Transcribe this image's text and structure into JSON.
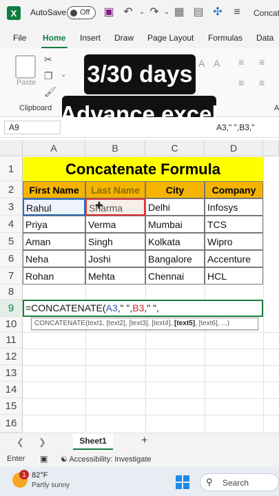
{
  "titlebar": {
    "logo": "X",
    "autosave_label": "AutoSave",
    "toggle_state": "Off",
    "doc_title": "Concat"
  },
  "menu": {
    "tabs": [
      "File",
      "Home",
      "Insert",
      "Draw",
      "Page Layout",
      "Formulas",
      "Data"
    ],
    "active": "Home"
  },
  "ribbon": {
    "paste_label": "Paste",
    "clipboard_label": "Clipboard",
    "overflow_label": "A"
  },
  "overlay": {
    "line1": "3/30 days",
    "line2": "Advance excel"
  },
  "formula_bar": {
    "name_box": "A9",
    "content": "A3,\"  \",B3,\""
  },
  "grid": {
    "columns": [
      "A",
      "B",
      "C",
      "D"
    ],
    "rows": [
      "1",
      "2",
      "3",
      "4",
      "5",
      "6",
      "7",
      "8",
      "9",
      "10",
      "11",
      "12",
      "13",
      "14",
      "15",
      "16"
    ],
    "title": "Concatenate Formula",
    "headers": [
      "First Name",
      "Last Name",
      "City",
      "Company"
    ],
    "data": [
      [
        "Rahul",
        "Sharma",
        "Delhi",
        "Infosys"
      ],
      [
        "Priya",
        "Verma",
        "Mumbai",
        "TCS"
      ],
      [
        "Aman",
        "Singh",
        "Kolkata",
        "Wipro"
      ],
      [
        "Neha",
        "Joshi",
        "Bangalore",
        "Accenture"
      ],
      [
        "Rohan",
        "Mehta",
        "Chennai",
        "HCL"
      ]
    ],
    "formula_parts": {
      "prefix": "=CONCATENATE(",
      "ref1": "A3",
      "mid1": ",\" \",",
      "ref2": "B3",
      "suffix": ",\" \","
    },
    "tooltip": {
      "fn": "CONCATENATE(",
      "args_plain": "text1, [text2], [text3], [text4], ",
      "arg_bold": "[text5]",
      "args_rest": ", [text6], ...)"
    }
  },
  "sheets": {
    "tabs": [
      "Sheet1"
    ],
    "add": "+"
  },
  "status": {
    "mode": "Enter",
    "accessibility": "Accessibility: Investigate"
  },
  "taskbar": {
    "badge": "1",
    "temperature": "82°F",
    "condition": "Partly sunny",
    "search_placeholder": "Search"
  },
  "colors": {
    "excel_green": "#107c41",
    "title_fill": "#ffff00",
    "header_fill": "#f4b400",
    "ref_blue": "#2f55b5",
    "ref_red": "#c62828"
  }
}
